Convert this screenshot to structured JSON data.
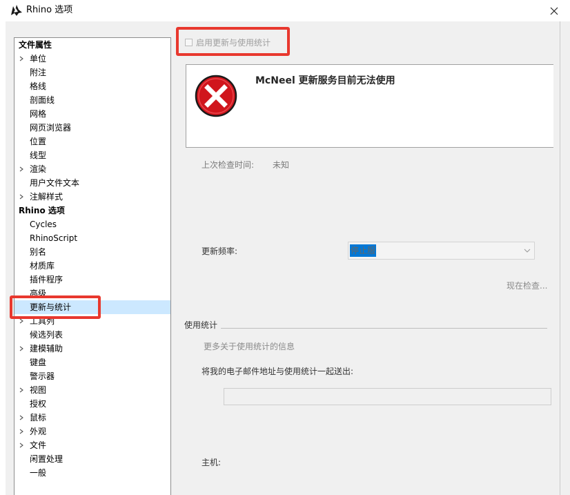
{
  "window": {
    "title": "Rhino 选项",
    "app_icon": "rhino-logo-icon",
    "close_icon": "close-icon"
  },
  "tree": {
    "items": [
      {
        "label": "文件属性",
        "level": 0,
        "bold": true,
        "expandable": false
      },
      {
        "label": "单位",
        "level": 1,
        "expandable": true
      },
      {
        "label": "附注",
        "level": 1,
        "expandable": false
      },
      {
        "label": "格线",
        "level": 1,
        "expandable": false
      },
      {
        "label": "剖面线",
        "level": 1,
        "expandable": false
      },
      {
        "label": "网格",
        "level": 1,
        "expandable": false
      },
      {
        "label": "网页浏览器",
        "level": 1,
        "expandable": false
      },
      {
        "label": "位置",
        "level": 1,
        "expandable": false
      },
      {
        "label": "线型",
        "level": 1,
        "expandable": false
      },
      {
        "label": "渲染",
        "level": 1,
        "expandable": true
      },
      {
        "label": "用户文件文本",
        "level": 1,
        "expandable": false
      },
      {
        "label": "注解样式",
        "level": 1,
        "expandable": true
      },
      {
        "label": "Rhino 选项",
        "level": 0,
        "bold": true,
        "expandable": false
      },
      {
        "label": "Cycles",
        "level": 1,
        "expandable": false
      },
      {
        "label": "RhinoScript",
        "level": 1,
        "expandable": false
      },
      {
        "label": "别名",
        "level": 1,
        "expandable": false
      },
      {
        "label": "材质库",
        "level": 1,
        "expandable": false
      },
      {
        "label": "插件程序",
        "level": 1,
        "expandable": false
      },
      {
        "label": "高级",
        "level": 1,
        "expandable": false
      },
      {
        "label": "更新与统计",
        "level": 1,
        "expandable": false,
        "selected": true
      },
      {
        "label": "工具列",
        "level": 1,
        "expandable": true
      },
      {
        "label": "候选列表",
        "level": 1,
        "expandable": false
      },
      {
        "label": "建模辅助",
        "level": 1,
        "expandable": true
      },
      {
        "label": "键盘",
        "level": 1,
        "expandable": false
      },
      {
        "label": "警示器",
        "level": 1,
        "expandable": false
      },
      {
        "label": "视图",
        "level": 1,
        "expandable": true
      },
      {
        "label": "授权",
        "level": 1,
        "expandable": false
      },
      {
        "label": "鼠标",
        "level": 1,
        "expandable": true
      },
      {
        "label": "外观",
        "level": 1,
        "expandable": true
      },
      {
        "label": "文件",
        "level": 1,
        "expandable": true
      },
      {
        "label": "闲置处理",
        "level": 1,
        "expandable": false
      },
      {
        "label": "一般",
        "level": 1,
        "expandable": false
      }
    ]
  },
  "updates": {
    "enable_checkbox_label": "启用更新与使用统计",
    "enable_checked": false,
    "error_icon": "error-x-icon",
    "error_message": "McNeel 更新服务目前无法使用",
    "last_check_label": "上次检查时间:",
    "last_check_value": "未知",
    "frequency_label": "更新频率:",
    "frequency_value": "停止服",
    "frequency_arrow_icon": "chevron-down-icon",
    "check_now_label": "现在检查..."
  },
  "usage_stats": {
    "group_label": "使用统计",
    "more_info_label": "更多关于使用统计的信息",
    "email_label": "将我的电子邮件地址与使用统计一起送出:",
    "email_value": "",
    "host_label": "主机:"
  },
  "colors": {
    "highlight_red": "#e8382e",
    "selection_blue": "#cce8ff",
    "dialog_bg": "#f0f0f0",
    "error_red": "#d0151c"
  }
}
